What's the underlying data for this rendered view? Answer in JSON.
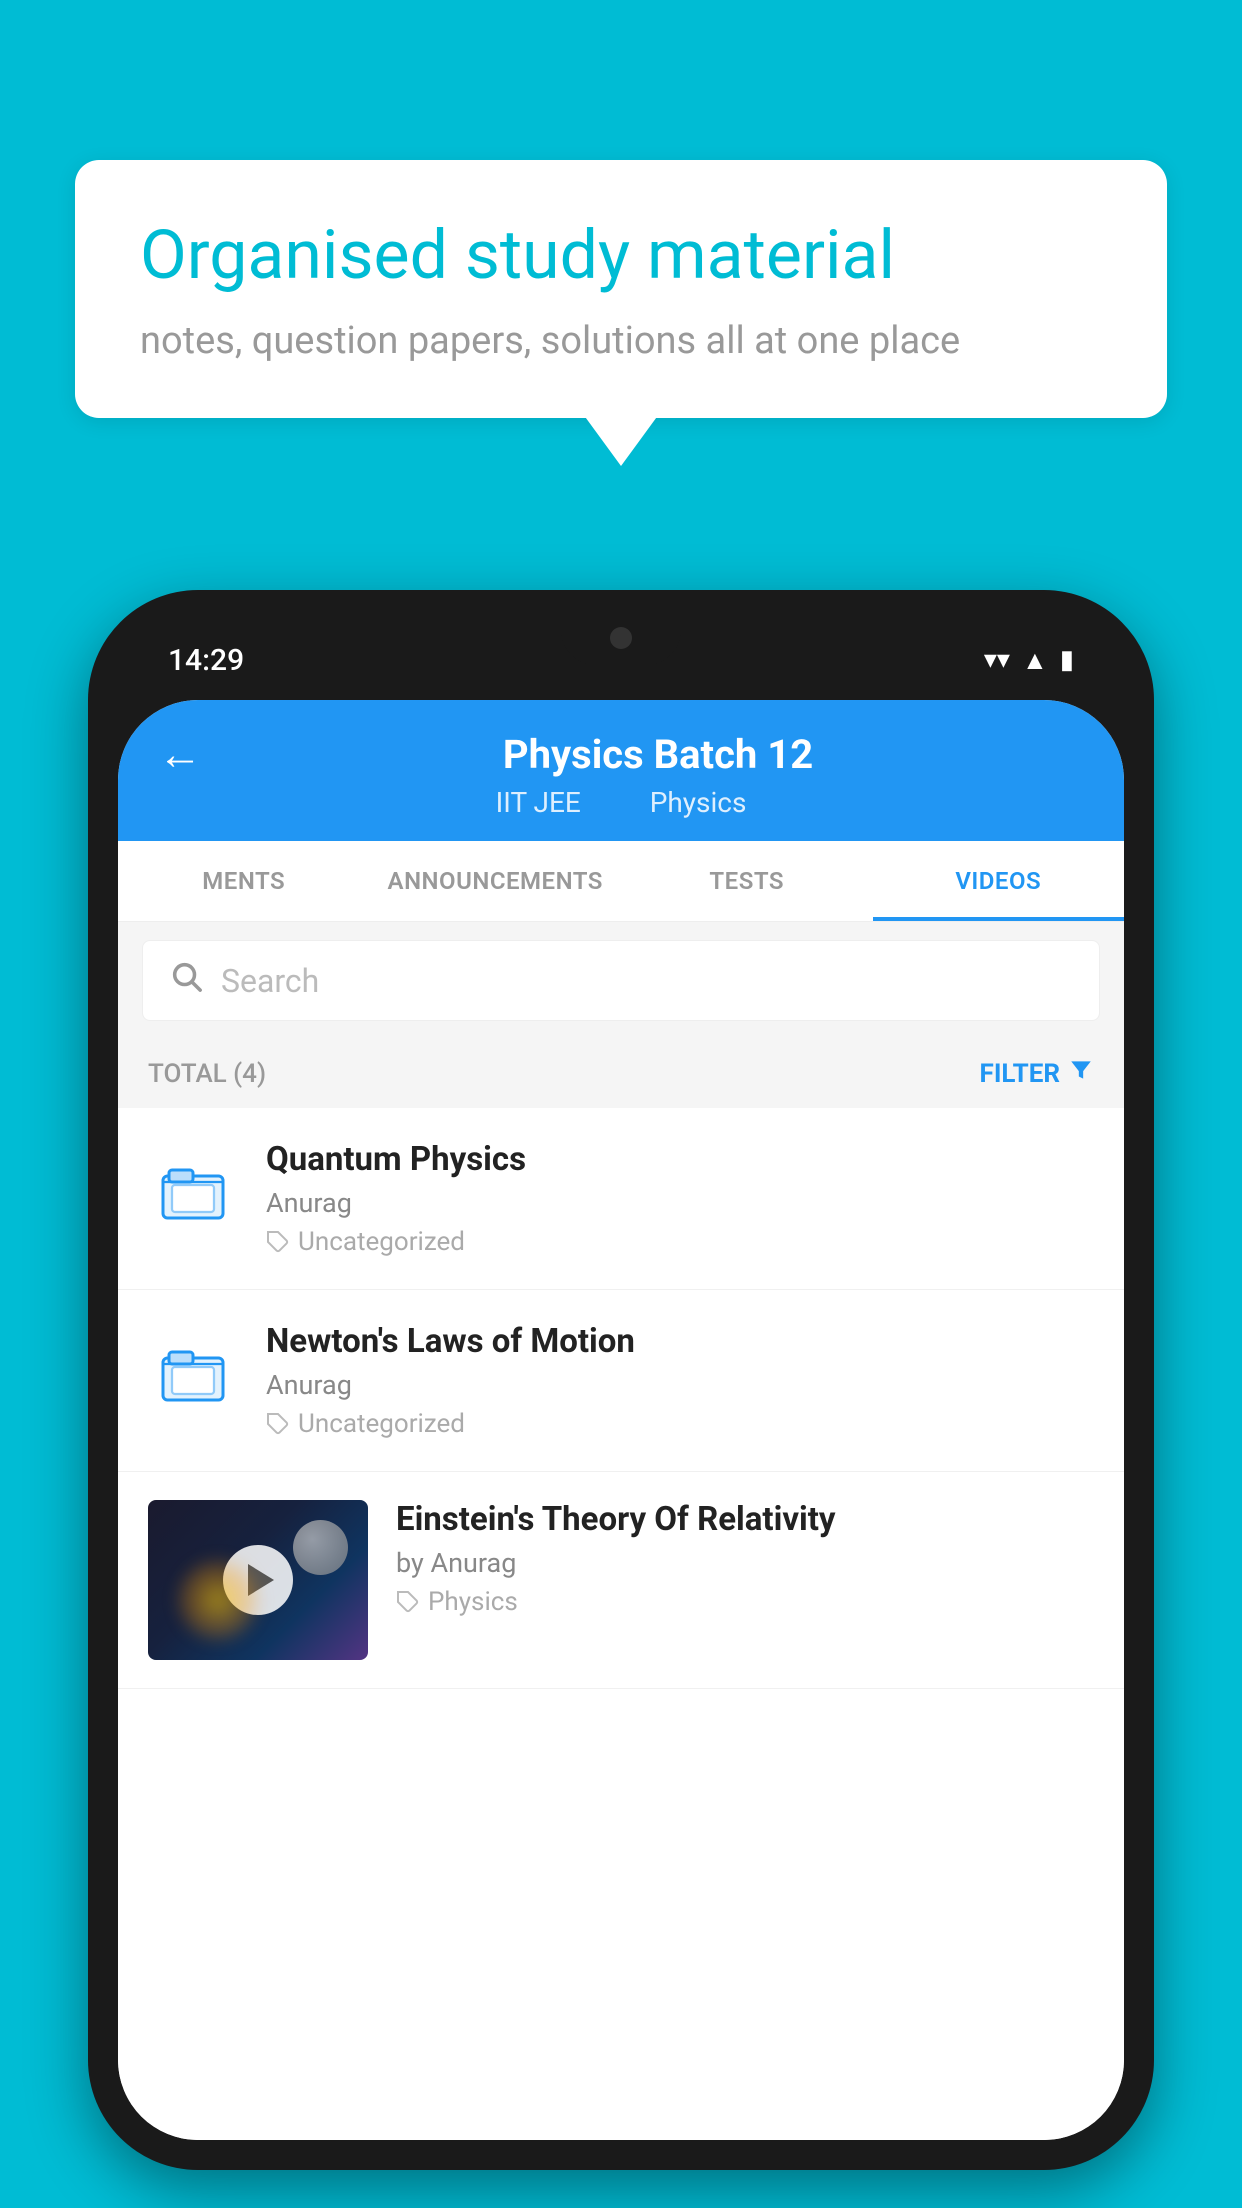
{
  "background_color": "#00bcd4",
  "speech_bubble": {
    "heading": "Organised study material",
    "subtext": "notes, question papers, solutions all at one place"
  },
  "phone": {
    "status_bar": {
      "time": "14:29"
    },
    "app_bar": {
      "title": "Physics Batch 12",
      "subtitle_tag1": "IIT JEE",
      "subtitle_tag2": "Physics",
      "back_label": "←"
    },
    "tabs": [
      {
        "label": "MENTS",
        "active": false
      },
      {
        "label": "ANNOUNCEMENTS",
        "active": false
      },
      {
        "label": "TESTS",
        "active": false
      },
      {
        "label": "VIDEOS",
        "active": true
      }
    ],
    "search": {
      "placeholder": "Search"
    },
    "filter_bar": {
      "total_label": "TOTAL (4)",
      "filter_label": "FILTER"
    },
    "videos": [
      {
        "id": 1,
        "title": "Quantum Physics",
        "author": "Anurag",
        "tag": "Uncategorized",
        "type": "folder"
      },
      {
        "id": 2,
        "title": "Newton's Laws of Motion",
        "author": "Anurag",
        "tag": "Uncategorized",
        "type": "folder"
      },
      {
        "id": 3,
        "title": "Einstein's Theory Of Relativity",
        "author": "by Anurag",
        "tag": "Physics",
        "type": "video"
      }
    ]
  }
}
